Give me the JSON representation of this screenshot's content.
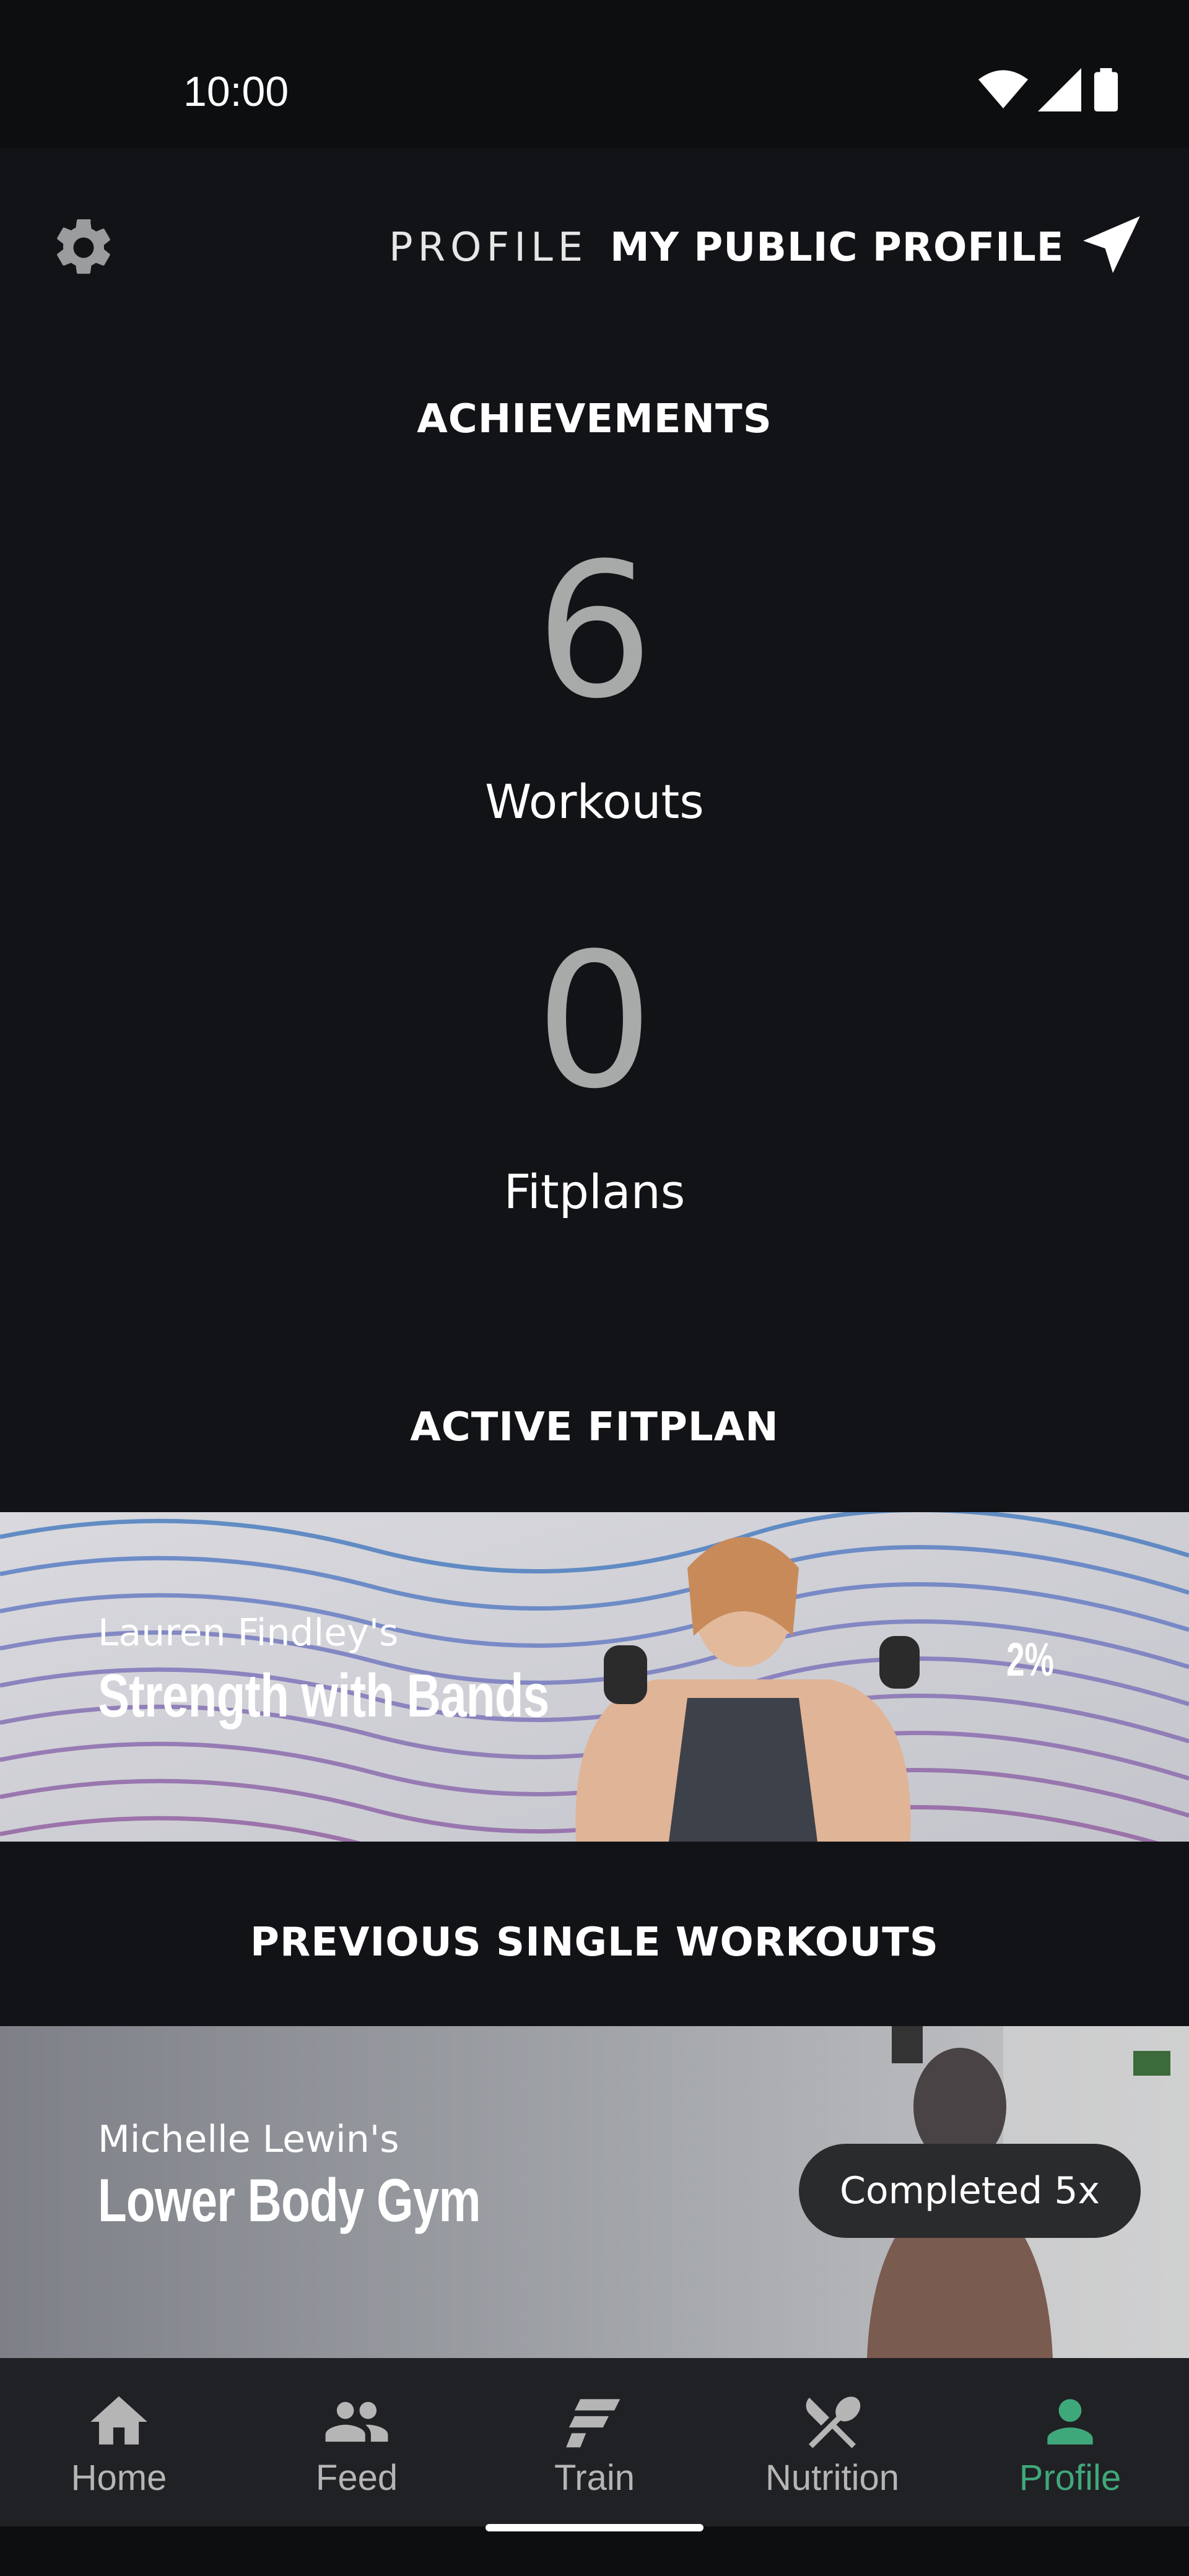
{
  "status_bar": {
    "time": "10:00"
  },
  "header": {
    "tabs": [
      {
        "label": "PROFILE"
      },
      {
        "label": "MY PUBLIC PROFILE"
      }
    ]
  },
  "achievements": {
    "title": "ACHIEVEMENTS",
    "workouts_count": "6",
    "workouts_label": "Workouts",
    "fitplans_count": "0",
    "fitplans_label": "Fitplans"
  },
  "active_fitplan": {
    "title": "ACTIVE FITPLAN",
    "owner": "Lauren Findley's",
    "name": "Strength with Bands",
    "progress": "2%"
  },
  "previous_workouts": {
    "title": "PREVIOUS SINGLE WORKOUTS",
    "items": [
      {
        "owner": "Michelle Lewin's",
        "name": "Lower Body Gym",
        "badge": "Completed 5x"
      }
    ]
  },
  "bottom_nav": {
    "items": [
      {
        "label": "Home",
        "icon": "home-icon"
      },
      {
        "label": "Feed",
        "icon": "people-icon"
      },
      {
        "label": "Train",
        "icon": "train-icon"
      },
      {
        "label": "Nutrition",
        "icon": "fork-knife-icon"
      },
      {
        "label": "Profile",
        "icon": "person-icon",
        "active": true
      }
    ],
    "active_color": "#3fa87a",
    "inactive_color": "#b5b5b5"
  }
}
